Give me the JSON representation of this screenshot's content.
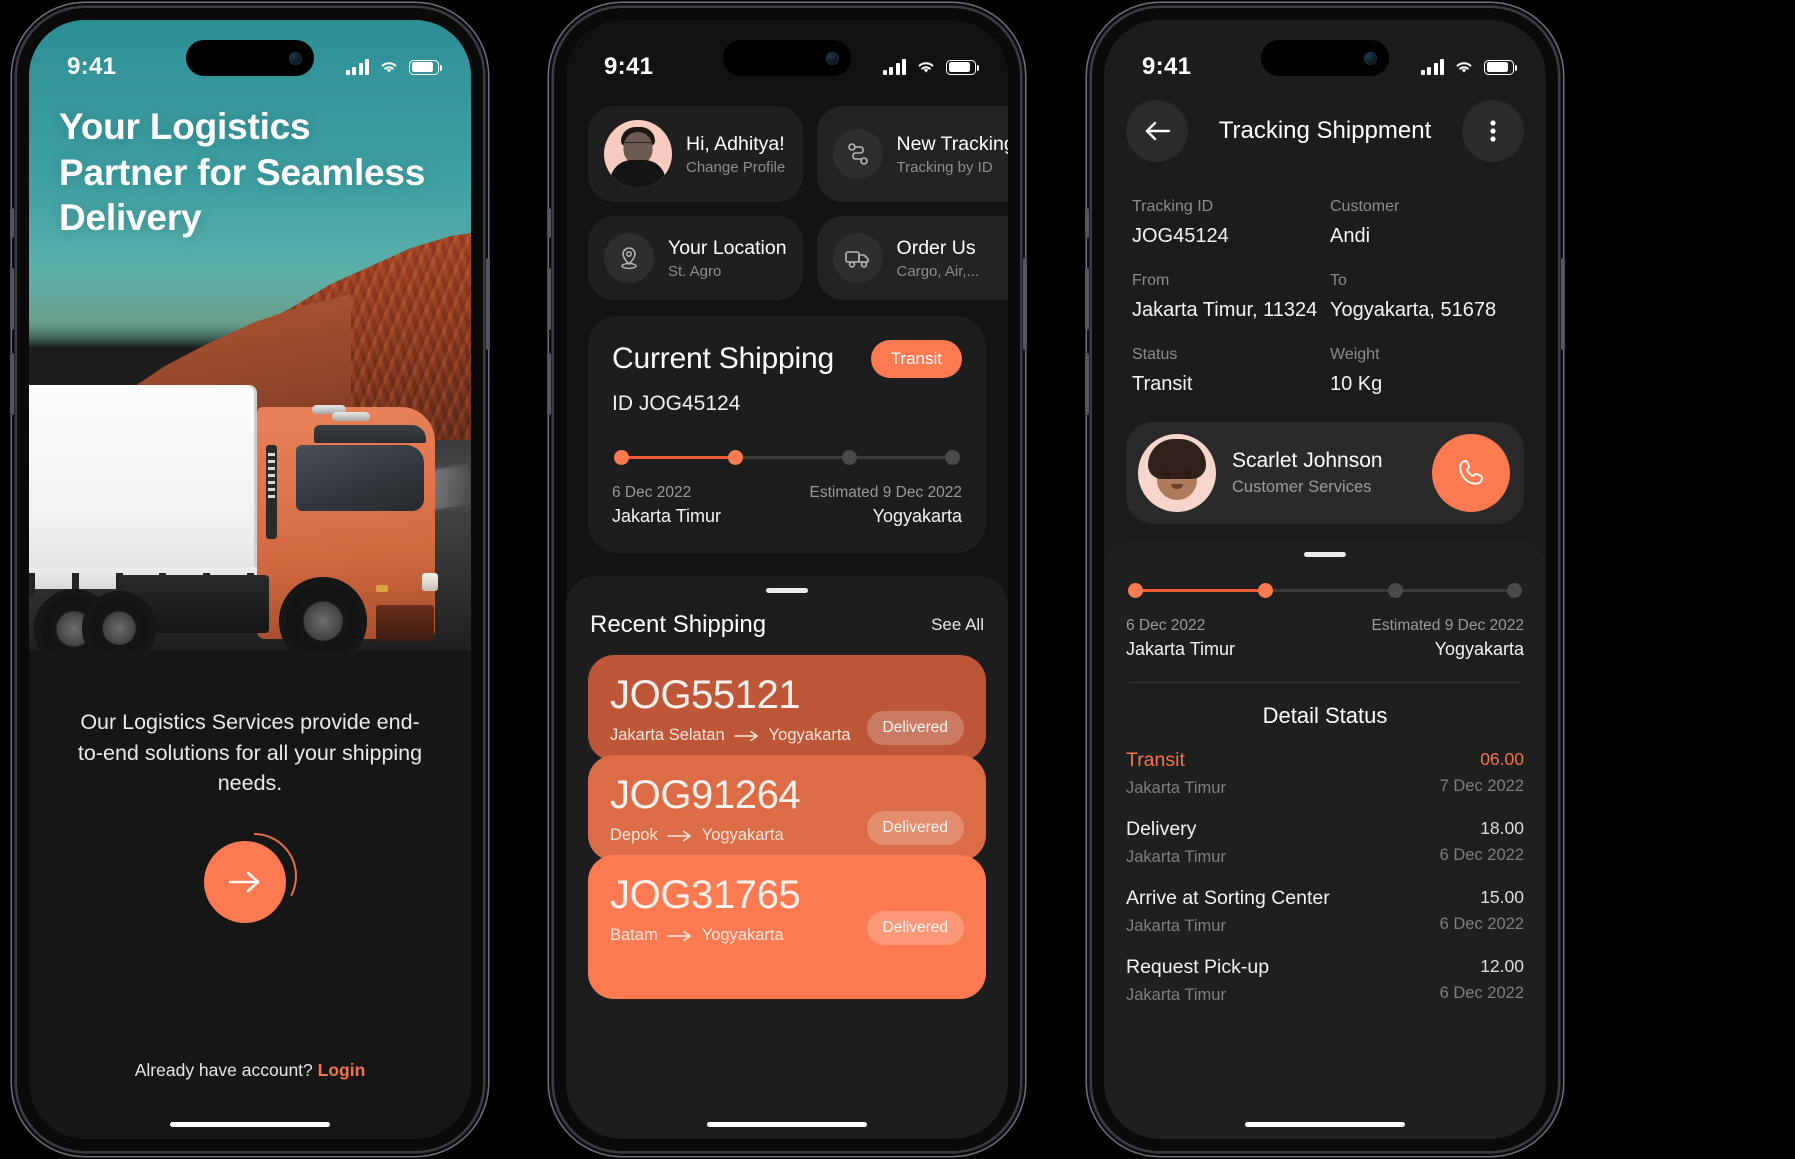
{
  "status_bar": {
    "time": "9:41"
  },
  "theme": {
    "accent": "#fb7a52",
    "accent_dark": "#ef5b38",
    "background": "#000000",
    "card": "#1d1d1d",
    "muted_text": "#8d8d8d"
  },
  "screen1": {
    "hero_title": "Your Logistics Partner for Seamless Delivery",
    "subcopy": "Our Logistics Services provide end-to-end solutions for all your shipping needs.",
    "cta_icon": "arrow-right-icon",
    "footer_prefix": "Already have account? ",
    "footer_link": "Login"
  },
  "screen2": {
    "quick_actions": [
      {
        "title": "Hi, Adhitya!",
        "subtitle": "Change  Profile",
        "icon": "user-avatar"
      },
      {
        "title": "New Tracking",
        "subtitle": "Tracking by ID",
        "icon": "route-icon"
      },
      {
        "title": "Your Location",
        "subtitle": "St. Agro",
        "icon": "location-pin-icon"
      },
      {
        "title": "Order Us",
        "subtitle": "Cargo, Air,...",
        "icon": "truck-icon"
      }
    ],
    "current_shipping": {
      "title": "Current Shipping",
      "status_pill": "Transit",
      "id_label": "ID JOG45124",
      "start_date": "6 Dec 2022",
      "start_place": "Jakarta Timur",
      "end_date": "Estimated 9 Dec 2022",
      "end_place": "Yogyakarta",
      "steps_total": 4,
      "steps_done": 2
    },
    "recent": {
      "title": "Recent Shipping",
      "see_all": "See All",
      "items": [
        {
          "code": "JOG55121",
          "from": "Jakarta Selatan",
          "to": "Yogyakarta",
          "badge": "Delivered",
          "color": "#bd5738"
        },
        {
          "code": "JOG91264",
          "from": "Depok",
          "to": "Yogyakarta",
          "badge": "Delivered",
          "color": "#db6c46"
        },
        {
          "code": "JOG31765",
          "from": "Batam",
          "to": "Yogyakarta",
          "badge": "Delivered",
          "color": "#fb7a52"
        }
      ]
    }
  },
  "screen3": {
    "title": "Tracking Shippment",
    "back_icon": "arrow-left-icon",
    "menu_icon": "more-vertical-icon",
    "fields": [
      {
        "label": "Tracking ID",
        "value": "JOG45124"
      },
      {
        "label": "Customer",
        "value": "Andi"
      },
      {
        "label": "From",
        "value": "Jakarta Timur, 11324"
      },
      {
        "label": "To",
        "value": "Yogyakarta, 51678"
      },
      {
        "label": "Status",
        "value": "Transit"
      },
      {
        "label": "Weight",
        "value": "10 Kg"
      }
    ],
    "agent": {
      "name": "Scarlet Johnson",
      "role": "Customer Services",
      "call_icon": "phone-icon"
    },
    "progress": {
      "start_date": "6 Dec 2022",
      "start_place": "Jakarta Timur",
      "end_date": "Estimated 9 Dec 2022",
      "end_place": "Yogyakarta",
      "steps_total": 4,
      "steps_done": 2
    },
    "detail_title": "Detail Status",
    "detail_rows": [
      {
        "name": "Transit",
        "place": "Jakarta Timur",
        "time": "06.00",
        "date": "7 Dec 2022",
        "active": true
      },
      {
        "name": "Delivery",
        "place": "Jakarta Timur",
        "time": "18.00",
        "date": "6 Dec 2022",
        "active": false
      },
      {
        "name": "Arrive at Sorting Center",
        "place": "Jakarta Timur",
        "time": "15.00",
        "date": "6 Dec 2022",
        "active": false
      },
      {
        "name": "Request Pick-up",
        "place": "Jakarta Timur",
        "time": "12.00",
        "date": "6 Dec 2022",
        "active": false
      }
    ]
  }
}
